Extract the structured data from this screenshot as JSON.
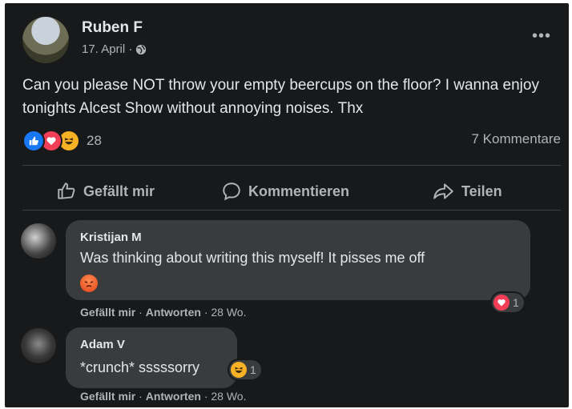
{
  "post": {
    "author": "Ruben F",
    "date": "17. April ·",
    "privacy_icon": "globe-icon",
    "text": "Can you please NOT throw your empty beercups on the floor? I wanna enjoy tonights Alcest Show without annoying noises. Thx",
    "reaction_icons": [
      "like-icon",
      "love-icon",
      "haha-icon"
    ],
    "reaction_count": "28",
    "comment_count": "7 Kommentare"
  },
  "actions": {
    "like": "Gefällt mir",
    "comment": "Kommentieren",
    "share": "Teilen"
  },
  "comments": [
    {
      "author": "Kristijan M",
      "text": "Was thinking about writing this myself! It pisses me off",
      "emoji": "angry-emoji",
      "meta_like": "Gefällt mir",
      "meta_sep1": "·",
      "meta_reply": "Antworten",
      "meta_time": "· 28 Wo.",
      "reaction_icon": "love-icon",
      "reaction_count": "1"
    },
    {
      "author": "Adam V",
      "text": "*crunch* sssssorry",
      "meta_like": "Gefällt mir",
      "meta_sep1": "·",
      "meta_reply": "Antworten",
      "meta_time": "· 28 Wo.",
      "reaction_icon": "haha-icon",
      "reaction_count": "1"
    }
  ],
  "colors": {
    "background": "#18191a",
    "bubble": "#3a3b3c",
    "text": "#e4e6eb",
    "secondary": "#b0b3b8",
    "like": "#1877f2",
    "love": "#f33e58",
    "haha": "#f7b125"
  }
}
